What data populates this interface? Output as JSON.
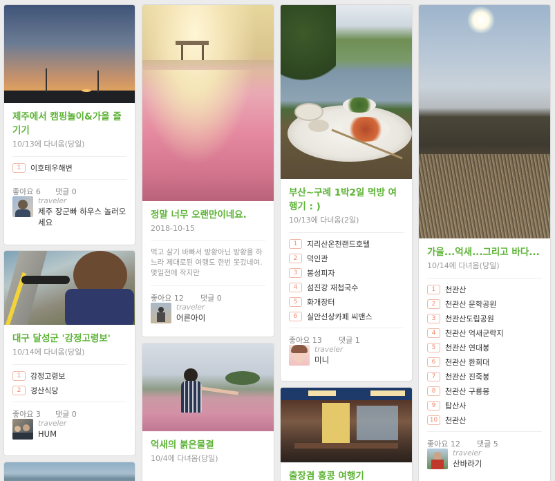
{
  "cards": {
    "jeju": {
      "title": "제주에서 캠핑놀이&가을 즐기기",
      "subtitle": "10/13에 다녀옴(당일)",
      "places": [
        "이호테우해변"
      ],
      "likes": "좋아요 6",
      "comments": "댓글 0",
      "role": "traveler",
      "author": "제주 장군빠 하우스 놀러오세요"
    },
    "daegu": {
      "title": "대구 달성군 '강정고령보'",
      "subtitle": "10/14에 다녀옴(당일)",
      "places": [
        "강정고령보",
        "경산식당"
      ],
      "likes": "좋아요 3",
      "comments": "댓글 0",
      "role": "traveler",
      "author": "HUM"
    },
    "long": {
      "title": "정말 너무 오랜만이네요.",
      "subtitle": "2018-10-15",
      "desc": "먹고 살기 바빠서 방황아닌 방황을 하느라 제대로된 여행도 한번 못갔네여. 몇일전에 작지만",
      "likes": "좋아요 12",
      "comments": "댓글 0",
      "role": "traveler",
      "author": "어른아이"
    },
    "eoksae": {
      "title": "억새의 붉은물결",
      "subtitle": "10/4에 다녀옴(당일)"
    },
    "busan": {
      "title": "부산~구례 1박2일 먹방 여행기 : )",
      "subtitle": "10/13에 다녀옴(2일)",
      "places": [
        "지리산온천랜드호텔",
        "덕인관",
        "봉성피자",
        "섬진강 재첩국수",
        "화개장터",
        "실안선상카페 씨맨스"
      ],
      "likes": "좋아요 13",
      "comments": "댓글 1",
      "role": "traveler",
      "author": "미니"
    },
    "hongkong": {
      "title": "출장겸 홍콩 여행기"
    },
    "autumn": {
      "title": "가을...억새...그리고 바다...",
      "subtitle": "10/14에 다녀옴(당일)",
      "places": [
        "천관산",
        "천관산 문학공원",
        "천관산도립공원",
        "천관산 억새군락지",
        "천관산 연대봉",
        "천관산 환희대",
        "천관산 진죽봉",
        "천관산 구룡봉",
        "탑산사",
        "천관산"
      ],
      "likes": "좋아요 12",
      "comments": "댓글 5",
      "role": "traveler",
      "author": "산바라기"
    }
  },
  "numbers": [
    "1",
    "2",
    "3",
    "4",
    "5",
    "6",
    "7",
    "8",
    "9",
    "10"
  ],
  "colors": {
    "accent": "#5cb335",
    "badge": "#f08a6f",
    "background": "#ececec"
  },
  "icons": [
    "photo",
    "avatar"
  ]
}
